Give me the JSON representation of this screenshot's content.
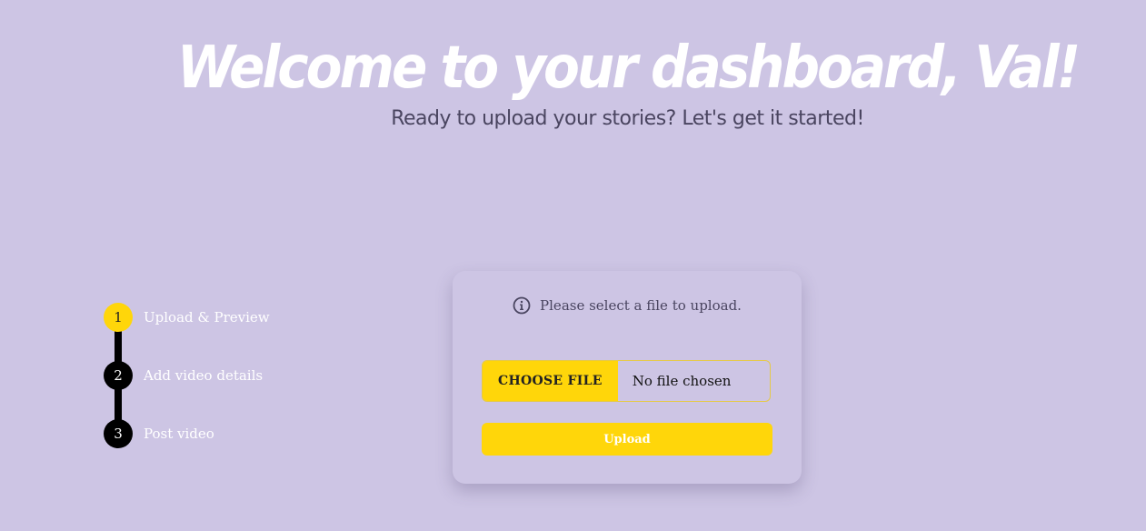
{
  "header": {
    "title": "Welcome to your dashboard, Val!",
    "subtitle": "Ready to upload your stories? Let's get it started!"
  },
  "stepper": {
    "steps": [
      {
        "number": "1",
        "label": "Upload & Preview",
        "active": true
      },
      {
        "number": "2",
        "label": "Add video details",
        "active": false
      },
      {
        "number": "3",
        "label": "Post video",
        "active": false
      }
    ]
  },
  "upload": {
    "info_text": "Please select a file to upload.",
    "choose_file_label": "CHOOSE FILE",
    "file_status": "No file chosen",
    "upload_label": "Upload"
  },
  "colors": {
    "background": "#cdc5e4",
    "accent": "#ffd60a",
    "step_inactive": "#000000"
  },
  "icons": {
    "info": "info-circle-icon"
  }
}
